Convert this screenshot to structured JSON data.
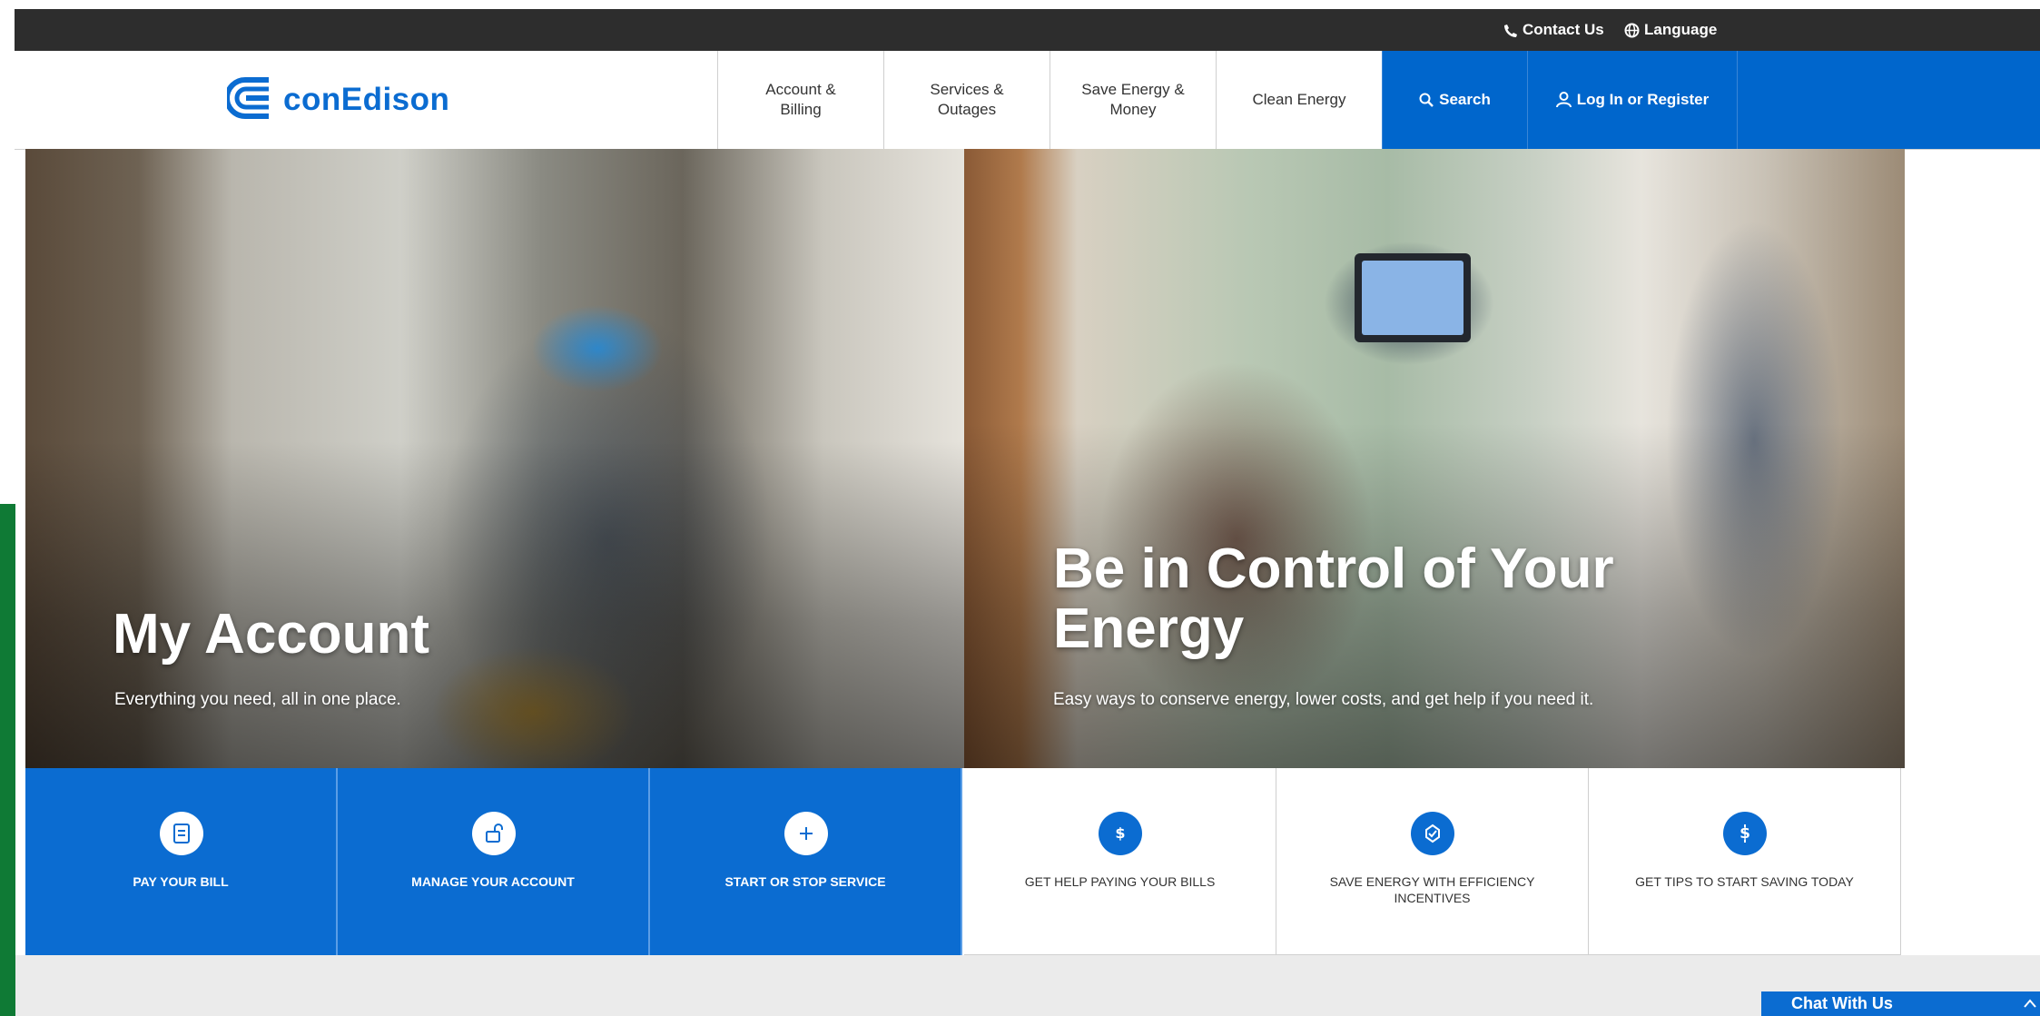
{
  "util": {
    "contact": "Contact Us",
    "language": "Language"
  },
  "header": {
    "logo_text": "conEdison"
  },
  "nav": {
    "account_billing": [
      "Account &",
      "Billing"
    ],
    "services_outages": [
      "Services &",
      "Outages"
    ],
    "save_energy": [
      "Save Energy &",
      "Money"
    ],
    "clean_energy": "Clean Energy",
    "search": "Search",
    "login": "Log In or Register"
  },
  "hero": {
    "left": {
      "title": "My Account",
      "subtitle": "Everything you need, all in one place."
    },
    "right": {
      "title": [
        "Be in Control of Your",
        "Energy"
      ],
      "subtitle": "Easy ways to conserve energy, lower costs, and get help if you need it."
    }
  },
  "tiles": [
    {
      "label": "PAY YOUR BILL",
      "icon": "bill-icon"
    },
    {
      "label": "MANAGE YOUR ACCOUNT",
      "icon": "lock-icon"
    },
    {
      "label": "START OR STOP SERVICE",
      "icon": "plus-icon"
    },
    {
      "label": "GET HELP PAYING YOUR BILLS",
      "icon": "dollar-icon"
    },
    {
      "label": [
        "SAVE ENERGY WITH EFFICIENCY",
        "INCENTIVES"
      ],
      "icon": "efficiency-icon"
    },
    {
      "label": "GET TIPS TO START SAVING TODAY",
      "icon": "dollar-circle-icon"
    }
  ],
  "chat": {
    "label": "Chat With Us"
  },
  "colors": {
    "brand_blue": "#0b6cd1",
    "topbar": "#2d2d2d",
    "accent_green": "#0f7a35"
  }
}
